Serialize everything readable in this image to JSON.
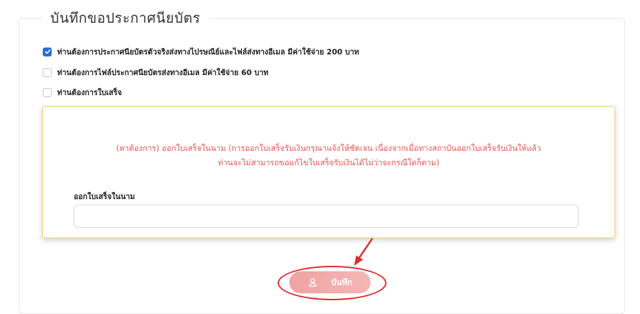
{
  "section": {
    "title": "บันทึกขอประกาศนียบัตร"
  },
  "options": [
    {
      "label": "ท่านต้องการประกาศนียบัตรตัวจริงส่งทางไปรษณีย์และไฟล์ส่งทางอีเมล มีค่าใช้จ่าย 200 บาท",
      "checked": true
    },
    {
      "label": "ท่านต้องการไฟล์ประกาศนียบัตรส่งทางอีเมล มีค่าใช้จ่าย 60 บาท",
      "checked": false
    },
    {
      "label": "ท่านต้องการใบเสร็จ",
      "checked": false
    }
  ],
  "receipt_panel": {
    "notice_line1": "(หาต้องการ) ออกใบเสร็จในนาม (การออกใบเสร็จรับเงินกรุณาแจ้งให้ชัดเจน เนื่องจากเมื่อทางสถาบันออกใบเสร็จรับเงินให้แล้ว",
    "notice_line2": "ท่านจะไม่สามารถขอแก้ไขใบเสร็จรับเงินได้ไม่ว่าจะกรณีใดก็ตาม)",
    "field_label": "ออกใบเสร็จในนาม",
    "field_value": ""
  },
  "save_button": {
    "label": "บันทึก",
    "icon": "user-icon"
  },
  "annotation": {
    "color": "#e0262a"
  }
}
